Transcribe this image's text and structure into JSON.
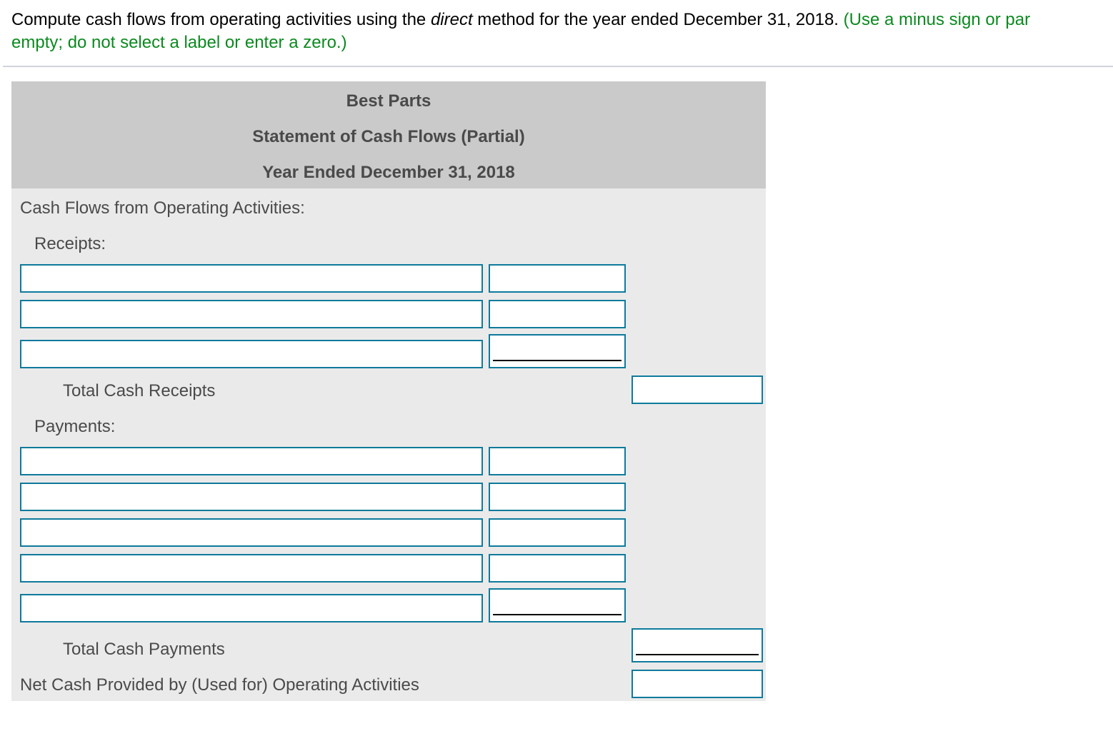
{
  "instructions": {
    "part1": "Compute cash flows from operating activities using the ",
    "emphasis": "direct",
    "part2": " method for the year ended December 31, 2018. ",
    "green_part1": "(Use a minus sign or par",
    "green_line2": "empty; do not select a label or enter a zero.)"
  },
  "statement": {
    "company": "Best Parts",
    "title": "Statement of Cash Flows (Partial)",
    "period": "Year Ended December 31, 2018",
    "section_heading": "Cash Flows from Operating Activities:",
    "receipts_label": "Receipts:",
    "receipts_rows": [
      {
        "description": "",
        "amount": ""
      },
      {
        "description": "",
        "amount": ""
      },
      {
        "description": "",
        "amount": ""
      }
    ],
    "total_receipts_label": "Total Cash Receipts",
    "total_receipts_value": "",
    "payments_label": "Payments:",
    "payments_rows": [
      {
        "description": "",
        "amount": ""
      },
      {
        "description": "",
        "amount": ""
      },
      {
        "description": "",
        "amount": ""
      },
      {
        "description": "",
        "amount": ""
      },
      {
        "description": "",
        "amount": ""
      }
    ],
    "total_payments_label": "Total Cash Payments",
    "total_payments_value": "",
    "net_cash_label": "Net Cash Provided by (Used for) Operating Activities",
    "net_cash_value": ""
  },
  "colors": {
    "instruction_green": "#0b8a1f",
    "input_border": "#0e7a9c",
    "header_bg": "#cacaca",
    "body_bg": "#eaeaea"
  }
}
